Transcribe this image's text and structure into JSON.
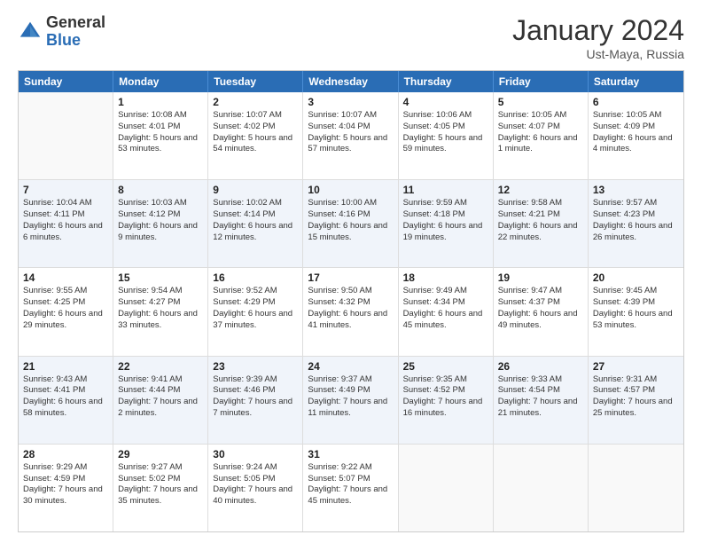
{
  "header": {
    "logo_general": "General",
    "logo_blue": "Blue",
    "month_title": "January 2024",
    "location": "Ust-Maya, Russia"
  },
  "calendar": {
    "days_of_week": [
      "Sunday",
      "Monday",
      "Tuesday",
      "Wednesday",
      "Thursday",
      "Friday",
      "Saturday"
    ],
    "weeks": [
      [
        {
          "day": "",
          "info": "",
          "empty": true
        },
        {
          "day": "1",
          "info": "Sunrise: 10:08 AM\nSunset: 4:01 PM\nDaylight: 5 hours\nand 53 minutes.",
          "empty": false
        },
        {
          "day": "2",
          "info": "Sunrise: 10:07 AM\nSunset: 4:02 PM\nDaylight: 5 hours\nand 54 minutes.",
          "empty": false
        },
        {
          "day": "3",
          "info": "Sunrise: 10:07 AM\nSunset: 4:04 PM\nDaylight: 5 hours\nand 57 minutes.",
          "empty": false
        },
        {
          "day": "4",
          "info": "Sunrise: 10:06 AM\nSunset: 4:05 PM\nDaylight: 5 hours\nand 59 minutes.",
          "empty": false
        },
        {
          "day": "5",
          "info": "Sunrise: 10:05 AM\nSunset: 4:07 PM\nDaylight: 6 hours\nand 1 minute.",
          "empty": false
        },
        {
          "day": "6",
          "info": "Sunrise: 10:05 AM\nSunset: 4:09 PM\nDaylight: 6 hours\nand 4 minutes.",
          "empty": false
        }
      ],
      [
        {
          "day": "7",
          "info": "Sunrise: 10:04 AM\nSunset: 4:11 PM\nDaylight: 6 hours\nand 6 minutes.",
          "empty": false
        },
        {
          "day": "8",
          "info": "Sunrise: 10:03 AM\nSunset: 4:12 PM\nDaylight: 6 hours\nand 9 minutes.",
          "empty": false
        },
        {
          "day": "9",
          "info": "Sunrise: 10:02 AM\nSunset: 4:14 PM\nDaylight: 6 hours\nand 12 minutes.",
          "empty": false
        },
        {
          "day": "10",
          "info": "Sunrise: 10:00 AM\nSunset: 4:16 PM\nDaylight: 6 hours\nand 15 minutes.",
          "empty": false
        },
        {
          "day": "11",
          "info": "Sunrise: 9:59 AM\nSunset: 4:18 PM\nDaylight: 6 hours\nand 19 minutes.",
          "empty": false
        },
        {
          "day": "12",
          "info": "Sunrise: 9:58 AM\nSunset: 4:21 PM\nDaylight: 6 hours\nand 22 minutes.",
          "empty": false
        },
        {
          "day": "13",
          "info": "Sunrise: 9:57 AM\nSunset: 4:23 PM\nDaylight: 6 hours\nand 26 minutes.",
          "empty": false
        }
      ],
      [
        {
          "day": "14",
          "info": "Sunrise: 9:55 AM\nSunset: 4:25 PM\nDaylight: 6 hours\nand 29 minutes.",
          "empty": false
        },
        {
          "day": "15",
          "info": "Sunrise: 9:54 AM\nSunset: 4:27 PM\nDaylight: 6 hours\nand 33 minutes.",
          "empty": false
        },
        {
          "day": "16",
          "info": "Sunrise: 9:52 AM\nSunset: 4:29 PM\nDaylight: 6 hours\nand 37 minutes.",
          "empty": false
        },
        {
          "day": "17",
          "info": "Sunrise: 9:50 AM\nSunset: 4:32 PM\nDaylight: 6 hours\nand 41 minutes.",
          "empty": false
        },
        {
          "day": "18",
          "info": "Sunrise: 9:49 AM\nSunset: 4:34 PM\nDaylight: 6 hours\nand 45 minutes.",
          "empty": false
        },
        {
          "day": "19",
          "info": "Sunrise: 9:47 AM\nSunset: 4:37 PM\nDaylight: 6 hours\nand 49 minutes.",
          "empty": false
        },
        {
          "day": "20",
          "info": "Sunrise: 9:45 AM\nSunset: 4:39 PM\nDaylight: 6 hours\nand 53 minutes.",
          "empty": false
        }
      ],
      [
        {
          "day": "21",
          "info": "Sunrise: 9:43 AM\nSunset: 4:41 PM\nDaylight: 6 hours\nand 58 minutes.",
          "empty": false
        },
        {
          "day": "22",
          "info": "Sunrise: 9:41 AM\nSunset: 4:44 PM\nDaylight: 7 hours\nand 2 minutes.",
          "empty": false
        },
        {
          "day": "23",
          "info": "Sunrise: 9:39 AM\nSunset: 4:46 PM\nDaylight: 7 hours\nand 7 minutes.",
          "empty": false
        },
        {
          "day": "24",
          "info": "Sunrise: 9:37 AM\nSunset: 4:49 PM\nDaylight: 7 hours\nand 11 minutes.",
          "empty": false
        },
        {
          "day": "25",
          "info": "Sunrise: 9:35 AM\nSunset: 4:52 PM\nDaylight: 7 hours\nand 16 minutes.",
          "empty": false
        },
        {
          "day": "26",
          "info": "Sunrise: 9:33 AM\nSunset: 4:54 PM\nDaylight: 7 hours\nand 21 minutes.",
          "empty": false
        },
        {
          "day": "27",
          "info": "Sunrise: 9:31 AM\nSunset: 4:57 PM\nDaylight: 7 hours\nand 25 minutes.",
          "empty": false
        }
      ],
      [
        {
          "day": "28",
          "info": "Sunrise: 9:29 AM\nSunset: 4:59 PM\nDaylight: 7 hours\nand 30 minutes.",
          "empty": false
        },
        {
          "day": "29",
          "info": "Sunrise: 9:27 AM\nSunset: 5:02 PM\nDaylight: 7 hours\nand 35 minutes.",
          "empty": false
        },
        {
          "day": "30",
          "info": "Sunrise: 9:24 AM\nSunset: 5:05 PM\nDaylight: 7 hours\nand 40 minutes.",
          "empty": false
        },
        {
          "day": "31",
          "info": "Sunrise: 9:22 AM\nSunset: 5:07 PM\nDaylight: 7 hours\nand 45 minutes.",
          "empty": false
        },
        {
          "day": "",
          "info": "",
          "empty": true
        },
        {
          "day": "",
          "info": "",
          "empty": true
        },
        {
          "day": "",
          "info": "",
          "empty": true
        }
      ]
    ]
  }
}
